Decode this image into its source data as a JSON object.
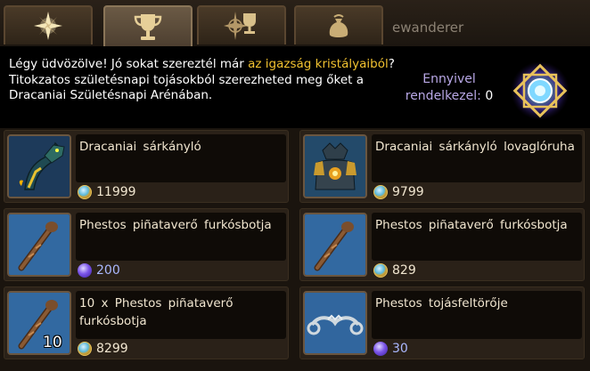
{
  "tabs": [
    {
      "name": "star-tab",
      "icon": "compass-star-icon"
    },
    {
      "name": "trophy-tab",
      "icon": "trophy-icon"
    },
    {
      "name": "compass-trophy-tab",
      "icon": "compass-trophy-icon"
    },
    {
      "name": "bag-tab",
      "icon": "money-bag-icon"
    }
  ],
  "username": "ewanderer",
  "banner": {
    "text_before": "Légy üdvözölve! Jó sokat szereztél már ",
    "highlight": "az igazság kristályaiból",
    "text_after": "? Titokzatos születésnapi tojásokból szerezheted meg őket a Dracaniai Születésnapi Arénában.",
    "balance_label": "Ennyivel rendelkezel:",
    "balance_value": "0",
    "currency_icon": "truth-crystal-icon"
  },
  "items": [
    {
      "name": "Dracaniai sárkányló",
      "price": "11999",
      "currency": "gold",
      "icon": "dragon-mount-icon",
      "qty": ""
    },
    {
      "name": "Dracaniai sárkányló lovaglóruha",
      "price": "9799",
      "currency": "gold",
      "icon": "riding-armor-icon",
      "qty": ""
    },
    {
      "name": "Phestos piñataverő furkósbotja",
      "price": "200",
      "currency": "purple",
      "icon": "club-icon",
      "qty": ""
    },
    {
      "name": "Phestos piñataverő furkósbotja",
      "price": "829",
      "currency": "gold",
      "icon": "club-icon",
      "qty": ""
    },
    {
      "name": "10 x Phestos piñataverő furkósbotja",
      "price": "8299",
      "currency": "gold",
      "icon": "club-icon",
      "qty": "10"
    },
    {
      "name": "Phestos tojásfeltörője",
      "price": "30",
      "currency": "purple",
      "icon": "egg-cracker-icon",
      "qty": ""
    }
  ]
}
